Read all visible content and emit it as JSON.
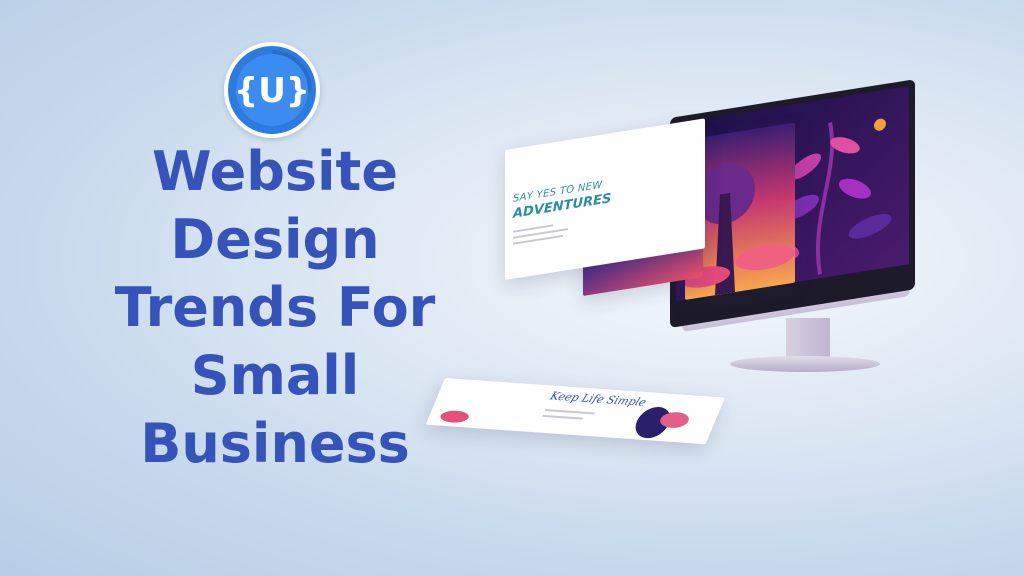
{
  "logo": {
    "glyph": "{U}",
    "colors": {
      "ring": "#2e7be0",
      "inner": "#3b8bf0",
      "shadow": "#1f5fb8"
    }
  },
  "title": {
    "lines": [
      "Website",
      "Design",
      "Trends For",
      "Small",
      "Business"
    ],
    "color": "#3553b8"
  },
  "illustration": {
    "card_heading_small": "SAY YES TO NEW",
    "card_heading_large": "ADVENTURES",
    "bottom_card_script": "Keep Life Simple"
  }
}
